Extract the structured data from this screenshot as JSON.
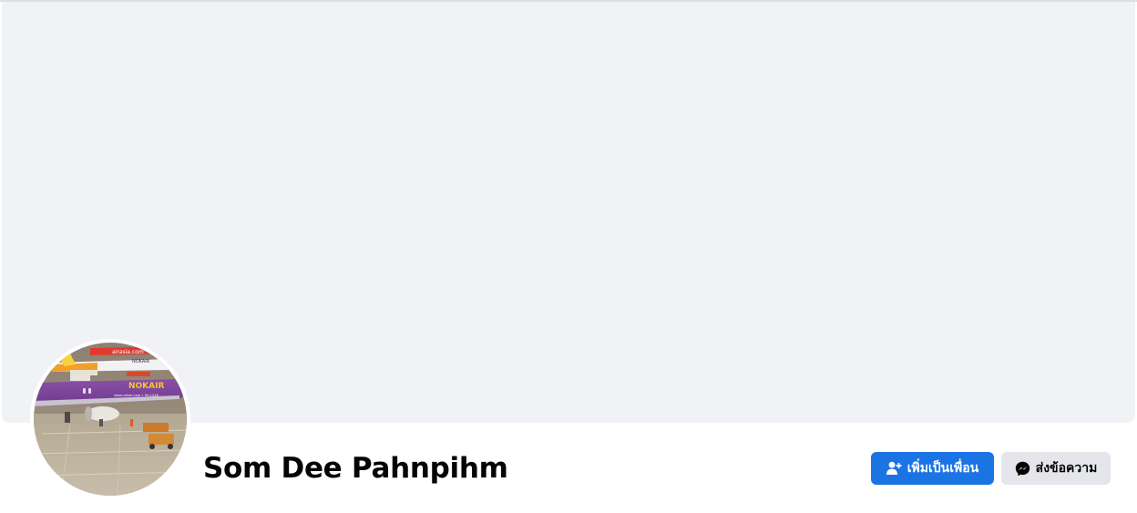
{
  "profile": {
    "name": "Som Dee Pahnpihm",
    "avatar_alt": "Nok Air and AirAsia aircraft on the apron",
    "avatar_text": {
      "airasia": "airasia.com",
      "nok_small": "NOKAIR",
      "nok_main": "NOKAIR",
      "nok_site": "www.nokair.com • Tel.1318"
    }
  },
  "actions": {
    "add_friend_label": "เพิ่มเป็นเพื่อน",
    "message_label": "ส่งข้อความ"
  },
  "icons": {
    "add_friend": "person-plus-icon",
    "message": "messenger-icon"
  },
  "colors": {
    "cover": "#f0f2f5",
    "primary": "#1b74e4",
    "secondary_button": "#e4e6eb",
    "text": "#050505"
  }
}
